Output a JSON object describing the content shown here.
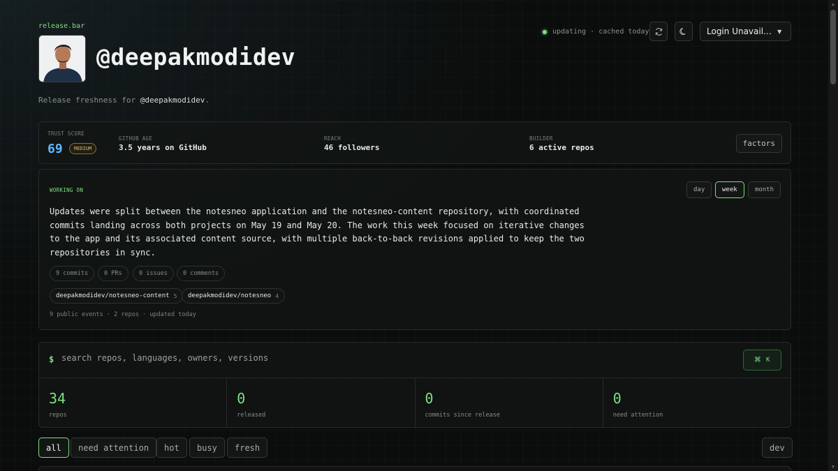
{
  "app": {
    "brand": "release.bar"
  },
  "profile": {
    "username": "@deepakmodidev",
    "subtitle_prefix": "Release freshness for ",
    "subtitle_handle": "@deepakmodidev",
    "subtitle_suffix": "."
  },
  "header": {
    "status_text": "updating · cached today",
    "login_label": "Login Unavail…"
  },
  "trust": {
    "score_label": "TRUST SCORE",
    "score": "69",
    "badge": "MEDIUM",
    "age_label": "GITHUB AGE",
    "age_value": "3.5 years on GitHub",
    "reach_label": "REACH",
    "reach_value": "46 followers",
    "builder_label": "BUILDER",
    "builder_value": "6 active repos",
    "factors_label": "factors"
  },
  "working_on": {
    "label": "WORKING ON",
    "periods": [
      "day",
      "week",
      "month"
    ],
    "active_period": "week",
    "summary": "Updates were split between the notesneo application and the notesneo-content repository, with coordinated commits landing across both projects on May 19 and May 20. The work this week focused on iterative changes to the app and its associated content source, with multiple back-to-back revisions applied to keep the two repositories in sync.",
    "chips": [
      "9 commits",
      "0 PRs",
      "0 issues",
      "0 comments"
    ],
    "repos": [
      {
        "name": "deepakmodidev/notesneo-content",
        "count": "5"
      },
      {
        "name": "deepakmodidev/notesneo",
        "count": "4"
      }
    ],
    "events": "9 public events · 2 repos · updated today"
  },
  "search": {
    "prompt": "$",
    "placeholder": "search repos, languages, owners, versions",
    "shortcut_symbol": "⌘",
    "shortcut_key": "K"
  },
  "stats": [
    {
      "value": "34",
      "label": "repos"
    },
    {
      "value": "0",
      "label": "released"
    },
    {
      "value": "0",
      "label": "commits since release"
    },
    {
      "value": "0",
      "label": "need attention"
    }
  ],
  "filters": [
    "all",
    "need attention",
    "hot",
    "busy",
    "fresh"
  ],
  "active_filter": "all",
  "sort_label": "dev",
  "colors": {
    "accent": "#7ee081",
    "score": "#62b8ff",
    "badge": "#e0b763",
    "background": "#0b0d0c"
  }
}
